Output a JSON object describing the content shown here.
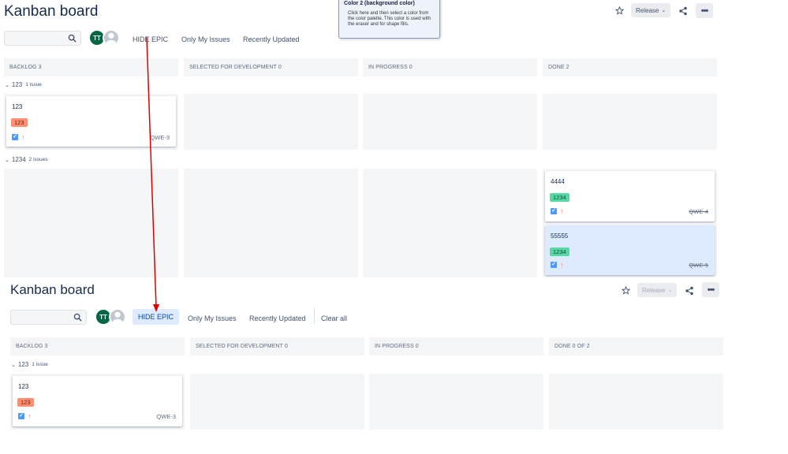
{
  "tooltip": {
    "title": "Color 2 (background color)",
    "body": "Click here and then select a color from the color palette. This color is used with the eraser and for shape fills."
  },
  "top": {
    "title": "Kanban board",
    "avatar_initials": "TT",
    "filters": [
      "HIDE EPIC",
      "Only My Issues",
      "Recently Updated"
    ],
    "release_label": "Release",
    "columns": [
      "BACKLOG 3",
      "SELECTED FOR DEVELOPMENT 0",
      "IN PROGRESS 0",
      "DONE 2"
    ],
    "swimlanes": [
      {
        "name": "123",
        "count": "1 issue"
      },
      {
        "name": "1234",
        "count": "2 issues"
      }
    ],
    "cards": [
      {
        "title": "123",
        "label": "123",
        "key": "QWE-3"
      },
      {
        "title": "4444",
        "label": "1234",
        "key": "QWE-4"
      },
      {
        "title": "55555",
        "label": "1234",
        "key": "QWE-5"
      }
    ]
  },
  "bottom": {
    "title": "Kanban board",
    "avatar_initials": "TT",
    "filters": [
      "HIDE EPIC",
      "Only My Issues",
      "Recently Updated"
    ],
    "clear_all": "Clear all",
    "release_label": "Release",
    "columns": [
      "BACKLOG 3",
      "SELECTED FOR DEVELOPMENT 0",
      "IN PROGRESS 0",
      "DONE 0 of 2"
    ],
    "swimlanes": [
      {
        "name": "123",
        "count": "1 issue"
      }
    ],
    "cards": [
      {
        "title": "123",
        "label": "123",
        "key": "QWE-3"
      }
    ]
  },
  "colors": {
    "annotation_arrow": "#e00000",
    "label_red": "#ff8f73",
    "label_green": "#57d9a3",
    "selected_card": "#deebff",
    "avatar_green": "#006644"
  },
  "icons": [
    "search-icon",
    "star-icon",
    "chevron-down-icon",
    "share-icon",
    "more-icon",
    "checkbox-icon",
    "priority-arrow-up-icon",
    "user-avatar-icon"
  ]
}
